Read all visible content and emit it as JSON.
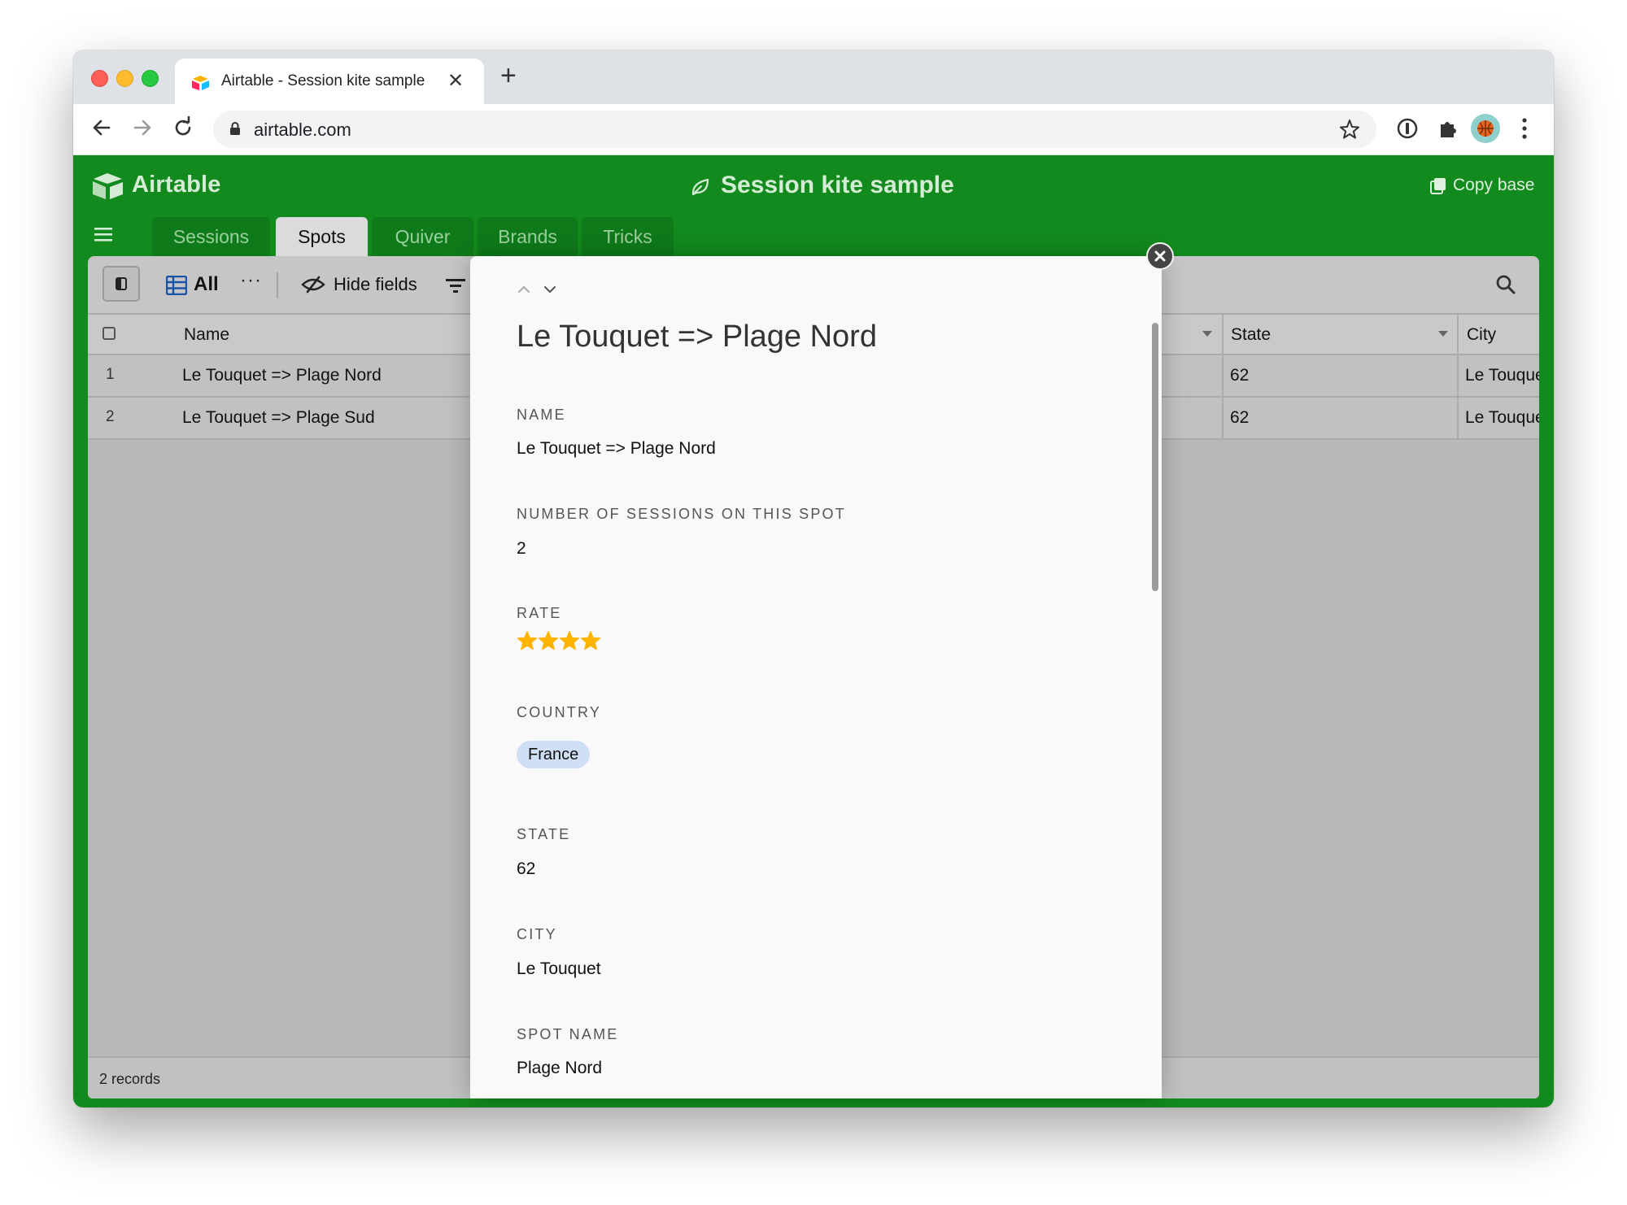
{
  "browser": {
    "tab_title": "Airtable - Session kite sample",
    "url": "airtable.com"
  },
  "app": {
    "logo_text": "Airtable",
    "base_title": "Session kite sample",
    "copy_base_label": "Copy base",
    "tables": [
      {
        "label": "Sessions",
        "active": false
      },
      {
        "label": "Spots",
        "active": true
      },
      {
        "label": "Quiver",
        "active": false
      },
      {
        "label": "Brands",
        "active": false
      },
      {
        "label": "Tricks",
        "active": false
      }
    ],
    "brand_color": "#128a1d"
  },
  "view": {
    "name": "All",
    "more_label": "···",
    "hide_fields_label": "Hide fields"
  },
  "grid": {
    "columns": {
      "name": "Name",
      "state": "State",
      "city": "City"
    },
    "rows": [
      {
        "num": "1",
        "name": "Le Touquet => Plage Nord",
        "state": "62",
        "city": "Le Touquet"
      },
      {
        "num": "2",
        "name": "Le Touquet => Plage Sud",
        "state": "62",
        "city": "Le Touquet"
      }
    ],
    "records_count": "2 records"
  },
  "record": {
    "title": "Le Touquet => Plage Nord",
    "fields": {
      "name": {
        "label": "NAME",
        "value": "Le Touquet => Plage Nord"
      },
      "sessions": {
        "label": "NUMBER OF SESSIONS ON THIS SPOT",
        "value": "2"
      },
      "rate": {
        "label": "RATE",
        "value": 4,
        "max": 5,
        "star_color": "#fcb400"
      },
      "country": {
        "label": "COUNTRY",
        "value": "France"
      },
      "state": {
        "label": "STATE",
        "value": "62"
      },
      "city": {
        "label": "CITY",
        "value": "Le Touquet"
      },
      "spot_name": {
        "label": "SPOT NAME",
        "value": "Plage Nord"
      }
    }
  }
}
